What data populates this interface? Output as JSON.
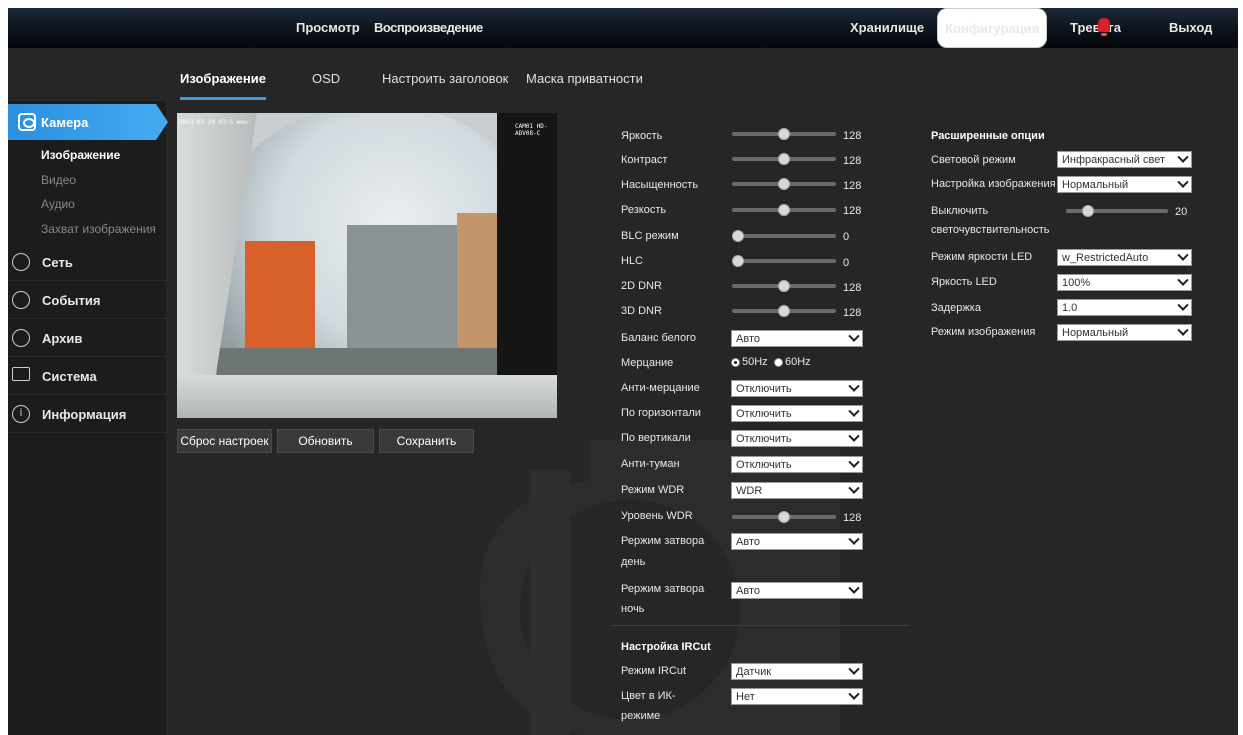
{
  "topnav": {
    "view": "Просмотр",
    "playback": "Воспроизведение",
    "storage": "Хранилище",
    "config": "Конфигурация",
    "alarm": "Тревога",
    "logout": "Выход"
  },
  "subtabs": [
    "Изображение",
    "OSD",
    "Настроить заголовок",
    "Маска приватности"
  ],
  "sidebar": {
    "camera": "Камера",
    "camera_items": [
      "Изображение",
      "Видео",
      "Аудио",
      "Захват изображения"
    ],
    "network": "Сеть",
    "events": "События",
    "archive": "Архив",
    "system": "Система",
    "info": "Информация"
  },
  "video": {
    "osd_left": "2023-03-20 03:5 мон",
    "osd_right": "CAM01 HD-ADV08-C"
  },
  "buttons": {
    "reset": "Сброс настроек",
    "refresh": "Обновить",
    "save": "Сохранить"
  },
  "image": {
    "brightness": {
      "label": "Яркость",
      "value": 128,
      "pct": 0.5
    },
    "contrast": {
      "label": "Контраст",
      "value": 128,
      "pct": 0.5
    },
    "saturation": {
      "label": "Насыщенность",
      "value": 128,
      "pct": 0.5
    },
    "sharpness": {
      "label": "Резкость",
      "value": 128,
      "pct": 0.5
    },
    "blc": {
      "label": "BLC режим",
      "value": 0,
      "pct": 0
    },
    "hlc": {
      "label": "HLC",
      "value": 0,
      "pct": 0
    },
    "dnr2d": {
      "label": "2D DNR",
      "value": 128,
      "pct": 0.5
    },
    "dnr3d": {
      "label": "3D DNR",
      "value": 128,
      "pct": 0.5
    },
    "white_balance": {
      "label": "Баланс белого",
      "value": "Авто"
    },
    "flicker": {
      "label": "Мерцание",
      "opt1": "50Hz",
      "opt2": "60Hz",
      "selected": "50Hz"
    },
    "anti_flicker": {
      "label": "Анти-мерцание",
      "value": "Отключить"
    },
    "flip_h": {
      "label": "По горизонтали",
      "value": "Отключить"
    },
    "flip_v": {
      "label": "По вертикали",
      "value": "Отключить"
    },
    "defog": {
      "label": "Анти-туман",
      "value": "Отключить"
    },
    "wdr_mode": {
      "label": "Режим WDR",
      "value": "WDR"
    },
    "wdr_level": {
      "label": "Уровень WDR",
      "value": 128,
      "pct": 0.5
    },
    "shutter_day": {
      "label1": "Рержим затвора",
      "label2": "день",
      "value": "Авто"
    },
    "shutter_night": {
      "label1": "Рержим затвора",
      "label2": "ночь",
      "value": "Авто"
    }
  },
  "ircut": {
    "title": "Настройка IRCut",
    "mode": {
      "label": "Режим IRCut",
      "value": "Датчик"
    },
    "color": {
      "label1": "Цвет в ИК-",
      "label2": "режиме",
      "value": "Нет"
    }
  },
  "advanced": {
    "title": "Расширенные опции",
    "light_mode": {
      "label": "Световой режим",
      "value": "Инфракрасный свет"
    },
    "image_setting": {
      "label": "Настройка изображения",
      "value": "Нормальный"
    },
    "sensitivity": {
      "label1": "Выключить",
      "label2": "светочувствительность",
      "value": 20,
      "pct": 0.22
    },
    "led_mode": {
      "label": "Режим яркости LED",
      "value": "w_RestrictedAuto"
    },
    "led_brightness": {
      "label": "Яркость LED",
      "value": "100%"
    },
    "delay": {
      "label": "Задержка",
      "value": "1.0"
    },
    "image_mode": {
      "label": "Режим изображения",
      "value": "Нормальный"
    }
  },
  "colors": {
    "accent": "#3a9be0",
    "background": "#262626"
  }
}
